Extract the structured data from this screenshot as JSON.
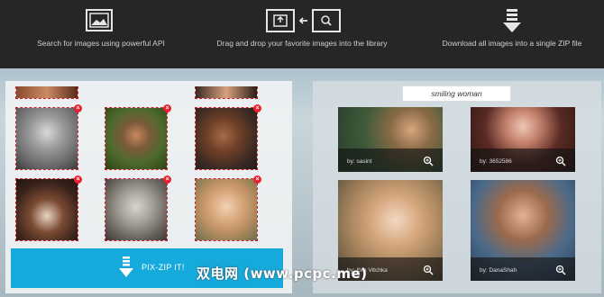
{
  "header": {
    "features": [
      {
        "icon": "image-frame-icon",
        "text": "Search for images using powerful API"
      },
      {
        "icon": "drag-to-library-icon",
        "text": "Drag and drop your favorite images into the library"
      },
      {
        "icon": "download-arrow-icon",
        "text": "Download all images into a single ZIP file"
      }
    ]
  },
  "library": {
    "button_label": "PIX-ZIP IT!",
    "remove_symbol": "×"
  },
  "search": {
    "query": "smiling woman",
    "results": [
      {
        "credit": "by: sasint"
      },
      {
        "credit": "by: 3652586"
      },
      {
        "credit": "by: Ibra Vitchka"
      },
      {
        "credit": "by: DanaShah"
      }
    ]
  },
  "watermark": "双电网 (www.pcpc.me)",
  "colors": {
    "header_bg": "#262626",
    "accent": "#16a9dc",
    "remove": "#e8202c",
    "dashed_border": "#d21e2b"
  }
}
